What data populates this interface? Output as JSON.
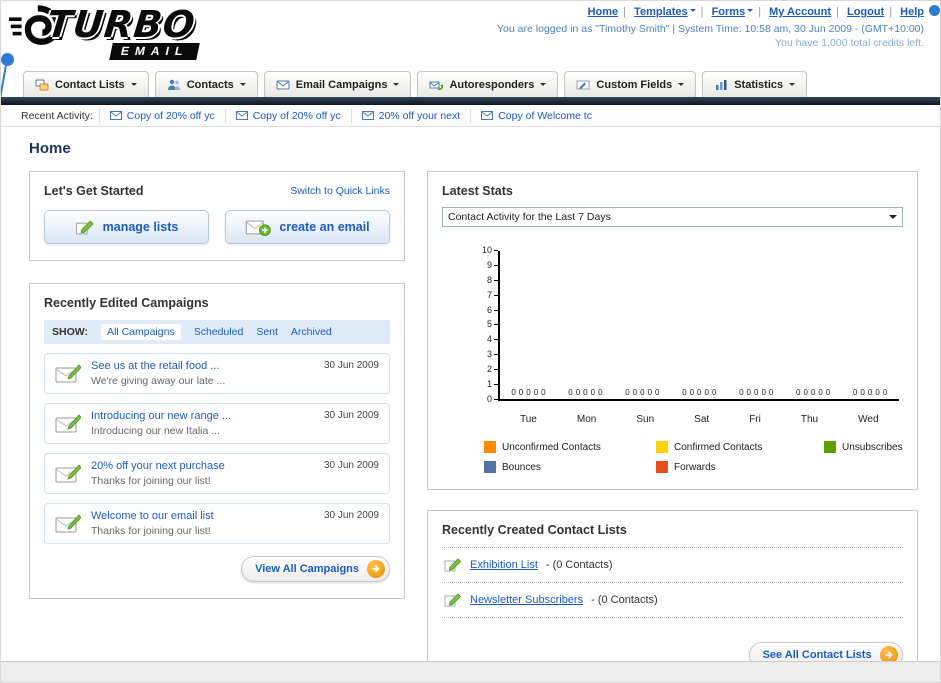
{
  "header": {
    "nav_links": [
      {
        "label": "Home"
      },
      {
        "label": "Templates"
      },
      {
        "label": "Forms"
      },
      {
        "label": "My Account"
      },
      {
        "label": "Logout"
      },
      {
        "label": "Help"
      }
    ],
    "login_info": "You are logged in as \"Timothy Smith\" | System Time: 10:58 am, 30 Jun 2009 - (GMT+10:00)",
    "credits_info": "You have 1,000 total credits left."
  },
  "nav": {
    "tabs": [
      {
        "label": "Contact Lists"
      },
      {
        "label": "Contacts"
      },
      {
        "label": "Email Campaigns"
      },
      {
        "label": "Autoresponders"
      },
      {
        "label": "Custom Fields"
      },
      {
        "label": "Statistics"
      }
    ]
  },
  "activity": {
    "label": "Recent Activity:",
    "items": [
      {
        "label": "Copy of 20% off yc"
      },
      {
        "label": "Copy of 20% off yc"
      },
      {
        "label": "20% off your next"
      },
      {
        "label": "Copy of Welcome tc"
      }
    ]
  },
  "page": {
    "title": "Home"
  },
  "get_started": {
    "title": "Let's Get Started",
    "switch_link": "Switch to Quick Links",
    "manage_lists_label": "manage lists",
    "create_email_label": "create an email"
  },
  "campaigns": {
    "title": "Recently Edited Campaigns",
    "show_label": "SHOW:",
    "filters": [
      {
        "label": "All Campaigns"
      },
      {
        "label": "Scheduled"
      },
      {
        "label": "Sent"
      },
      {
        "label": "Archived"
      }
    ],
    "items": [
      {
        "title": "See us at the retail food ...",
        "subtitle": "We're giving away our late ...",
        "date": "30 Jun 2009"
      },
      {
        "title": "Introducing our new range ...",
        "subtitle": "Introducing our new Italia ...",
        "date": "30 Jun 2009"
      },
      {
        "title": "20% off your next purchase",
        "subtitle": "Thanks for joining our list!",
        "date": "30 Jun 2009"
      },
      {
        "title": "Welcome to our email list",
        "subtitle": "Thanks for joining our list!",
        "date": "30 Jun 2009"
      }
    ],
    "view_all_label": "View All Campaigns"
  },
  "stats": {
    "title": "Latest Stats",
    "dropdown_value": "Contact Activity for the Last 7 Days",
    "chart_data": {
      "type": "bar",
      "title": "Contact Activity for the Last 7 Days",
      "categories": [
        "Tue",
        "Mon",
        "Sun",
        "Sat",
        "Fri",
        "Thu",
        "Wed"
      ],
      "series": [
        {
          "name": "Unconfirmed Contacts",
          "color": "#ff8a00",
          "values": [
            0,
            0,
            0,
            0,
            0,
            0,
            0
          ]
        },
        {
          "name": "Confirmed Contacts",
          "color": "#ffd400",
          "values": [
            0,
            0,
            0,
            0,
            0,
            0,
            0
          ]
        },
        {
          "name": "Unsubscribes",
          "color": "#5ba000",
          "values": [
            0,
            0,
            0,
            0,
            0,
            0,
            0
          ]
        },
        {
          "name": "Bounces",
          "color": "#5572a7",
          "values": [
            0,
            0,
            0,
            0,
            0,
            0,
            0
          ]
        },
        {
          "name": "Forwards",
          "color": "#e84d1c",
          "values": [
            0,
            0,
            0,
            0,
            0,
            0,
            0
          ]
        }
      ],
      "ylim": [
        0,
        10
      ],
      "yticks": [
        0,
        1,
        2,
        3,
        4,
        5,
        6,
        7,
        8,
        9,
        10
      ],
      "legend_position": "below",
      "grid": false
    }
  },
  "contact_lists": {
    "title": "Recently Created Contact Lists",
    "items": [
      {
        "name": "Exhibition List",
        "detail": "- (0 Contacts)"
      },
      {
        "name": "Newsletter Subscribers",
        "detail": "- (0 Contacts)"
      }
    ],
    "see_all_label": "See All Contact Lists"
  }
}
